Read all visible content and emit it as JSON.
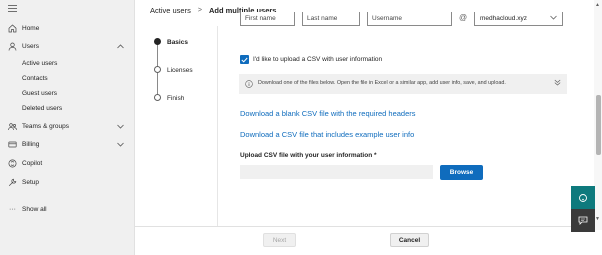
{
  "nav": {
    "home": "Home",
    "users": "Users",
    "active_users": "Active users",
    "contacts": "Contacts",
    "guest_users": "Guest users",
    "deleted_users": "Deleted users",
    "teams_groups": "Teams & groups",
    "billing": "Billing",
    "copilot": "Copilot",
    "setup": "Setup",
    "show_all": "Show all"
  },
  "breadcrumb": {
    "parent": "Active users",
    "separator": ">",
    "current": "Add multiple users"
  },
  "steps": [
    {
      "label": "Basics",
      "active": true
    },
    {
      "label": "Licenses",
      "active": false
    },
    {
      "label": "Finish",
      "active": false
    }
  ],
  "fields": {
    "first_name": "First name",
    "last_name": "Last name",
    "username": "Username",
    "at": "@",
    "domain": "medhacloud.xyz"
  },
  "checkbox": {
    "label": "I'd like to upload a CSV with user information",
    "checked": true
  },
  "info": {
    "text": "Download one of the files below. Open the file in Excel or a similar app, add user info, save, and upload."
  },
  "links": {
    "blank_csv": "Download a blank CSV file with the required headers",
    "example_csv": "Download a CSV file that includes example user info"
  },
  "upload": {
    "label": "Upload CSV file with your user information *",
    "browse": "Browse"
  },
  "footer": {
    "next": "Next",
    "cancel": "Cancel"
  },
  "colors": {
    "accent": "#0f6cbd",
    "help_fab": "#0e7a7d",
    "chat_fab": "#3a3a3a"
  }
}
